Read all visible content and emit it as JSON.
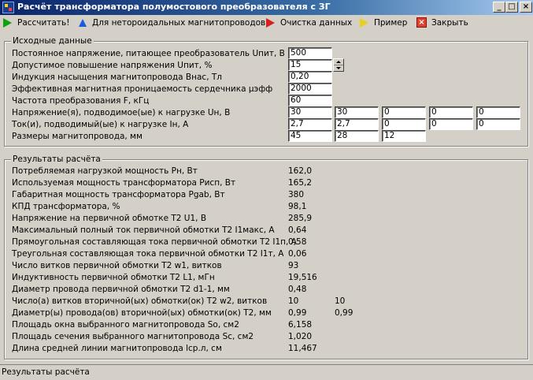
{
  "window": {
    "title": "Расчёт трансформатора полумостового преобразователя с ЗГ",
    "min_label": "_",
    "max_label": "□",
    "close_label": "×"
  },
  "toolbar": {
    "calculate": "Рассчитать!",
    "toroidal": "Для нетороидальных магнитопроводов",
    "clear": "Очистка данных",
    "example": "Пример",
    "close": "Закрыть"
  },
  "input_group": {
    "title": "Исходные данные",
    "rows": [
      {
        "label": "Постоянное напряжение, питающее преобразователь Uпит, В",
        "values": [
          "500"
        ]
      },
      {
        "label": "Допустимое повышение напряжения Uпит, %",
        "values": [
          "15"
        ]
      },
      {
        "label": "Индукция насыщения магнитопровода Внас, Тл",
        "values": [
          "0,20"
        ]
      },
      {
        "label": "Эффективная магнитная проницаемость сердечника μэфф",
        "values": [
          "2000"
        ]
      },
      {
        "label": "Частота преобразования F, кГц",
        "values": [
          "60"
        ]
      },
      {
        "label": "Напряжение(я), подводимое(ые) к нагрузке Uн, В",
        "values": [
          "30",
          "30",
          "0",
          "0",
          "0"
        ]
      },
      {
        "label": "Ток(и), подводимый(ые) к нагрузке Iн, А",
        "values": [
          "2,7",
          "2,7",
          "0",
          "0",
          "0"
        ]
      },
      {
        "label": "Размеры магнитопровода, мм",
        "values": [
          "45",
          "28",
          "12"
        ]
      }
    ]
  },
  "results_group": {
    "title": "Результаты расчёта",
    "rows": [
      {
        "label": "Потребляемая нагрузкой мощность Рн, Вт",
        "v1": "162,0",
        "v2": ""
      },
      {
        "label": "Используемая мощность трансформатора Рисп, Вт",
        "v1": "165,2",
        "v2": ""
      },
      {
        "label": "Габаритная мощность трансформатора Рgab, Вт",
        "v1": "380",
        "v2": ""
      },
      {
        "label": "КПД трансформатора, %",
        "v1": "98,1",
        "v2": ""
      },
      {
        "label": "Напряжение на первичной обмотке Т2 U1, В",
        "v1": "285,9",
        "v2": ""
      },
      {
        "label": "Максимальный полный ток первичной обмотки Т2 I1макс, А",
        "v1": "0,64",
        "v2": ""
      },
      {
        "label": "Прямоугольная составляющая тока первичной обмотки Т2 I1п, А",
        "v1": "0,58",
        "v2": ""
      },
      {
        "label": "Треугольная составляющая тока первичной обмотки Т2 I1т, А",
        "v1": "0,06",
        "v2": ""
      },
      {
        "label": "Число витков первичной обмотки Т2 w1, витков",
        "v1": "93",
        "v2": ""
      },
      {
        "label": "Индуктивность первичной обмотки Т2 L1, мГн",
        "v1": "19,516",
        "v2": ""
      },
      {
        "label": "Диаметр провода первичной обмотки Т2 d1-1, мм",
        "v1": "0,48",
        "v2": ""
      },
      {
        "label": "Число(а) витков вторичной(ых) обмотки(ок) Т2 w2, витков",
        "v1": "10",
        "v2": "10"
      },
      {
        "label": "Диаметр(ы) провода(ов) вторичной(ых) обмотки(ок) Т2, мм",
        "v1": "0,99",
        "v2": "0,99"
      },
      {
        "label": "Площадь окна выбранного магнитопровода So, см2",
        "v1": "6,158",
        "v2": ""
      },
      {
        "label": "Площадь сечения выбранного магнитопровода Sc, см2",
        "v1": "1,020",
        "v2": ""
      },
      {
        "label": "Длина средней линии магнитопровода lср.л, см",
        "v1": "11,467",
        "v2": ""
      }
    ]
  },
  "statusbar": {
    "text": "Результаты расчёта"
  },
  "colors": {
    "title_start": "#0a246a",
    "title_end": "#a6caf0",
    "face": "#d4d0c8"
  },
  "icons": [
    "app-icon",
    "green-arrow-icon",
    "blue-up-arrow-icon",
    "red-arrow-icon",
    "yellow-arrow-icon",
    "red-x-icon"
  ]
}
